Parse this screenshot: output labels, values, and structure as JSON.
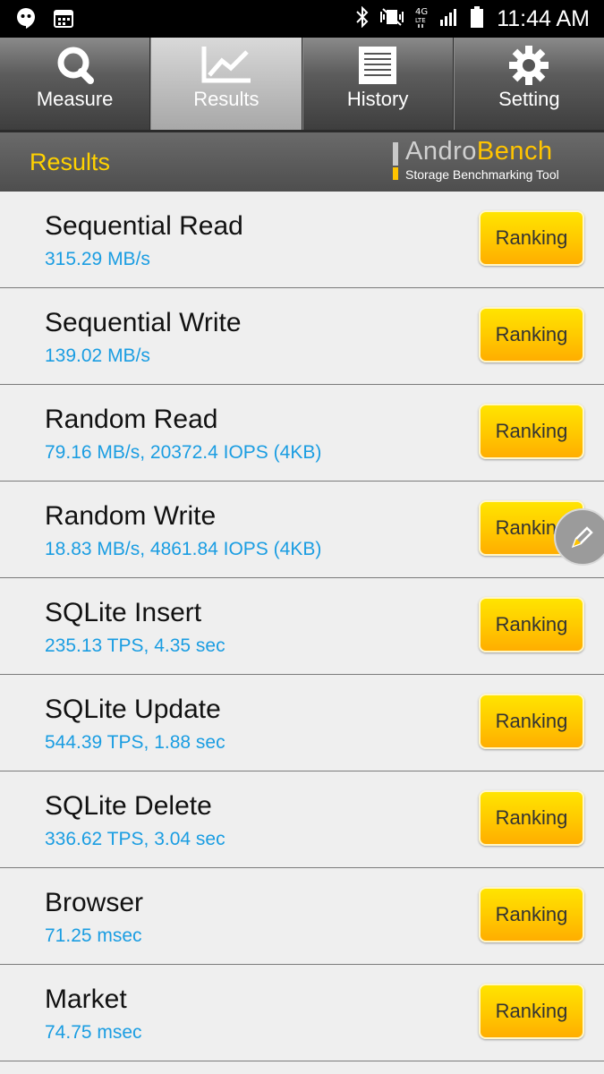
{
  "status_bar": {
    "time": "11:44 AM",
    "left_icons": [
      "hangouts-icon",
      "calendar-icon"
    ],
    "right_icons": [
      "bluetooth-icon",
      "vibrate-icon",
      "network-4g-icon",
      "signal-icon",
      "battery-icon"
    ]
  },
  "tabs": [
    {
      "label": "Measure",
      "icon": "magnifier-icon",
      "active": false
    },
    {
      "label": "Results",
      "icon": "chart-icon",
      "active": true
    },
    {
      "label": "History",
      "icon": "document-icon",
      "active": false
    },
    {
      "label": "Setting",
      "icon": "gear-icon",
      "active": false
    }
  ],
  "header": {
    "title": "Results",
    "logo": {
      "name_part1": "Andro",
      "name_part2": "Bench",
      "tagline": "Storage Benchmarking Tool"
    }
  },
  "results": [
    {
      "name": "Sequential Read",
      "value": "315.29 MB/s",
      "button": "Ranking"
    },
    {
      "name": "Sequential Write",
      "value": "139.02 MB/s",
      "button": "Ranking"
    },
    {
      "name": "Random Read",
      "value": "79.16 MB/s, 20372.4 IOPS (4KB)",
      "button": "Ranking"
    },
    {
      "name": "Random Write",
      "value": "18.83 MB/s, 4861.84 IOPS (4KB)",
      "button": "Ranking"
    },
    {
      "name": "SQLite Insert",
      "value": "235.13 TPS, 4.35 sec",
      "button": "Ranking"
    },
    {
      "name": "SQLite Update",
      "value": "544.39 TPS, 1.88 sec",
      "button": "Ranking"
    },
    {
      "name": "SQLite Delete",
      "value": "336.62 TPS, 3.04 sec",
      "button": "Ranking"
    },
    {
      "name": "Browser",
      "value": "71.25 msec",
      "button": "Ranking"
    },
    {
      "name": "Market",
      "value": "74.75 msec",
      "button": "Ranking"
    }
  ],
  "floating_button": {
    "icon": "pencil-icon"
  },
  "colors": {
    "accent": "#ffd200",
    "value_text": "#1a9de2",
    "button": "#ffc800"
  }
}
